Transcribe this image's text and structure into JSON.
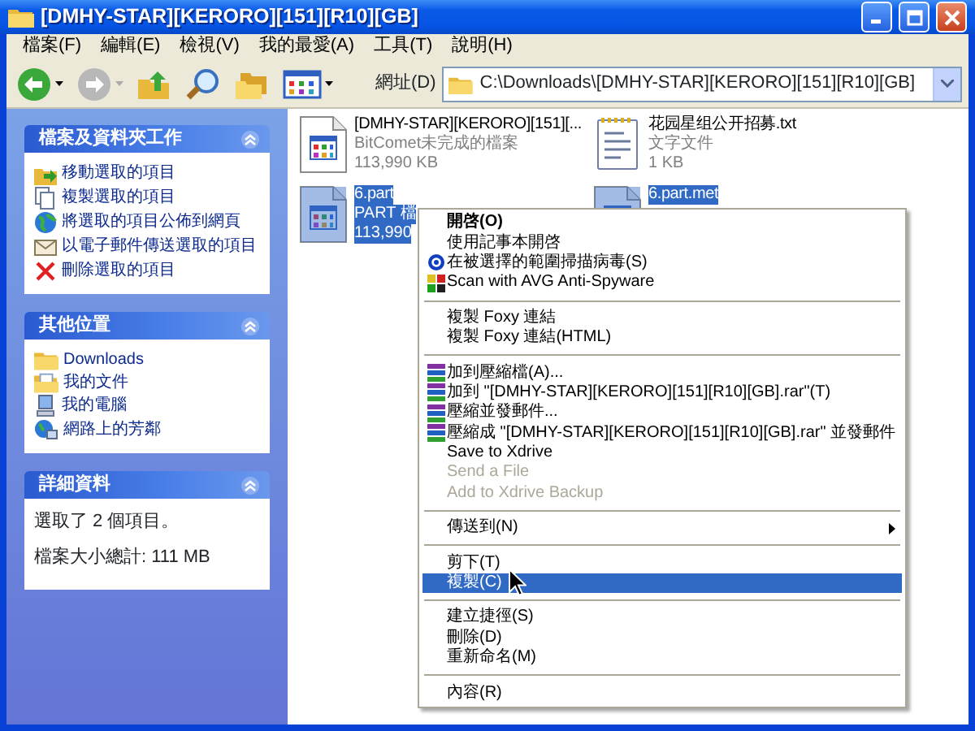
{
  "window": {
    "title": "[DMHY-STAR][KERORO][151][R10][GB]"
  },
  "menu_bar": [
    "檔案(F)",
    "編輯(E)",
    "檢視(V)",
    "我的最愛(A)",
    "工具(T)",
    "說明(H)"
  ],
  "toolbar": {
    "address_label": "網址(D)",
    "address": "C:\\Downloads\\[DMHY-STAR][KERORO][151][R10][GB]"
  },
  "sidebar": {
    "panels": [
      {
        "title": "檔案及資料夾工作",
        "kind": "links",
        "items": [
          "移動選取的項目",
          "複製選取的項目",
          "將選取的項目公佈到網頁",
          "以電子郵件傳送選取的項目",
          "刪除選取的項目"
        ]
      },
      {
        "title": "其他位置",
        "kind": "links",
        "items": [
          "Downloads",
          "我的文件",
          "我的電腦",
          "網路上的芳鄰"
        ]
      },
      {
        "title": "詳細資料",
        "kind": "details",
        "items": [
          "選取了 2 個項目。",
          "檔案大小總計: 111 MB"
        ]
      }
    ]
  },
  "files": [
    {
      "kind": "app",
      "name": "[DMHY-STAR][KERORO][151][...",
      "type": "BitComet未完成的檔案",
      "size": "113,990 KB",
      "selected": false
    },
    {
      "kind": "text",
      "name": "花园星组公开招募.txt",
      "type": "文字文件",
      "size": "1 KB",
      "selected": false
    },
    {
      "kind": "app",
      "name": "6.part",
      "type": "PART 檔",
      "size": "113,990",
      "selected": true
    },
    {
      "kind": "app",
      "name": "6.part.met",
      "selected": true
    }
  ],
  "context_menu": {
    "items": [
      {
        "kind": "item",
        "label": "開啓(O)",
        "default": true,
        "disabled": false,
        "selected": false,
        "submenu": false
      },
      {
        "kind": "item",
        "label": "使用記事本開啓",
        "default": false,
        "disabled": false,
        "selected": false,
        "submenu": false
      },
      {
        "kind": "item",
        "label": "在被選擇的範圍掃描病毒(S)",
        "default": false,
        "disabled": false,
        "selected": false,
        "submenu": false
      },
      {
        "kind": "item",
        "label": "Scan with AVG Anti-Spyware",
        "default": false,
        "disabled": false,
        "selected": false,
        "submenu": false
      },
      {
        "kind": "separator"
      },
      {
        "kind": "item",
        "label": "複製 Foxy 連結",
        "default": false,
        "disabled": false,
        "selected": false,
        "submenu": false
      },
      {
        "kind": "item",
        "label": "複製 Foxy 連結(HTML)",
        "default": false,
        "disabled": false,
        "selected": false,
        "submenu": false
      },
      {
        "kind": "separator"
      },
      {
        "kind": "item",
        "label": "加到壓縮檔(A)...",
        "default": false,
        "disabled": false,
        "selected": false,
        "submenu": false
      },
      {
        "kind": "item",
        "label": "加到 \"[DMHY-STAR][KERORO][151][R10][GB].rar\"(T)",
        "default": false,
        "disabled": false,
        "selected": false,
        "submenu": false
      },
      {
        "kind": "item",
        "label": "壓縮並發郵件...",
        "default": false,
        "disabled": false,
        "selected": false,
        "submenu": false
      },
      {
        "kind": "item",
        "label": "壓縮成 \"[DMHY-STAR][KERORO][151][R10][GB].rar\" 並發郵件",
        "default": false,
        "disabled": false,
        "selected": false,
        "submenu": false
      },
      {
        "kind": "item",
        "label": "Save to Xdrive",
        "default": false,
        "disabled": false,
        "selected": false,
        "submenu": false
      },
      {
        "kind": "item",
        "label": "Send a File",
        "default": false,
        "disabled": true,
        "selected": false,
        "submenu": false
      },
      {
        "kind": "item",
        "label": "Add to Xdrive Backup",
        "default": false,
        "disabled": true,
        "selected": false,
        "submenu": false
      },
      {
        "kind": "separator"
      },
      {
        "kind": "item",
        "label": "傳送到(N)",
        "default": false,
        "disabled": false,
        "selected": false,
        "submenu": true
      },
      {
        "kind": "separator"
      },
      {
        "kind": "item",
        "label": "剪下(T)",
        "default": false,
        "disabled": false,
        "selected": false,
        "submenu": false
      },
      {
        "kind": "item",
        "label": "複製(C)",
        "default": false,
        "disabled": false,
        "selected": true,
        "submenu": false
      },
      {
        "kind": "separator"
      },
      {
        "kind": "item",
        "label": "建立捷徑(S)",
        "default": false,
        "disabled": false,
        "selected": false,
        "submenu": false
      },
      {
        "kind": "item",
        "label": "刪除(D)",
        "default": false,
        "disabled": false,
        "selected": false,
        "submenu": false
      },
      {
        "kind": "item",
        "label": "重新命名(M)",
        "default": false,
        "disabled": false,
        "selected": false,
        "submenu": false
      },
      {
        "kind": "separator"
      },
      {
        "kind": "item",
        "label": "內容(R)",
        "default": false,
        "disabled": false,
        "selected": false,
        "submenu": false
      }
    ]
  }
}
